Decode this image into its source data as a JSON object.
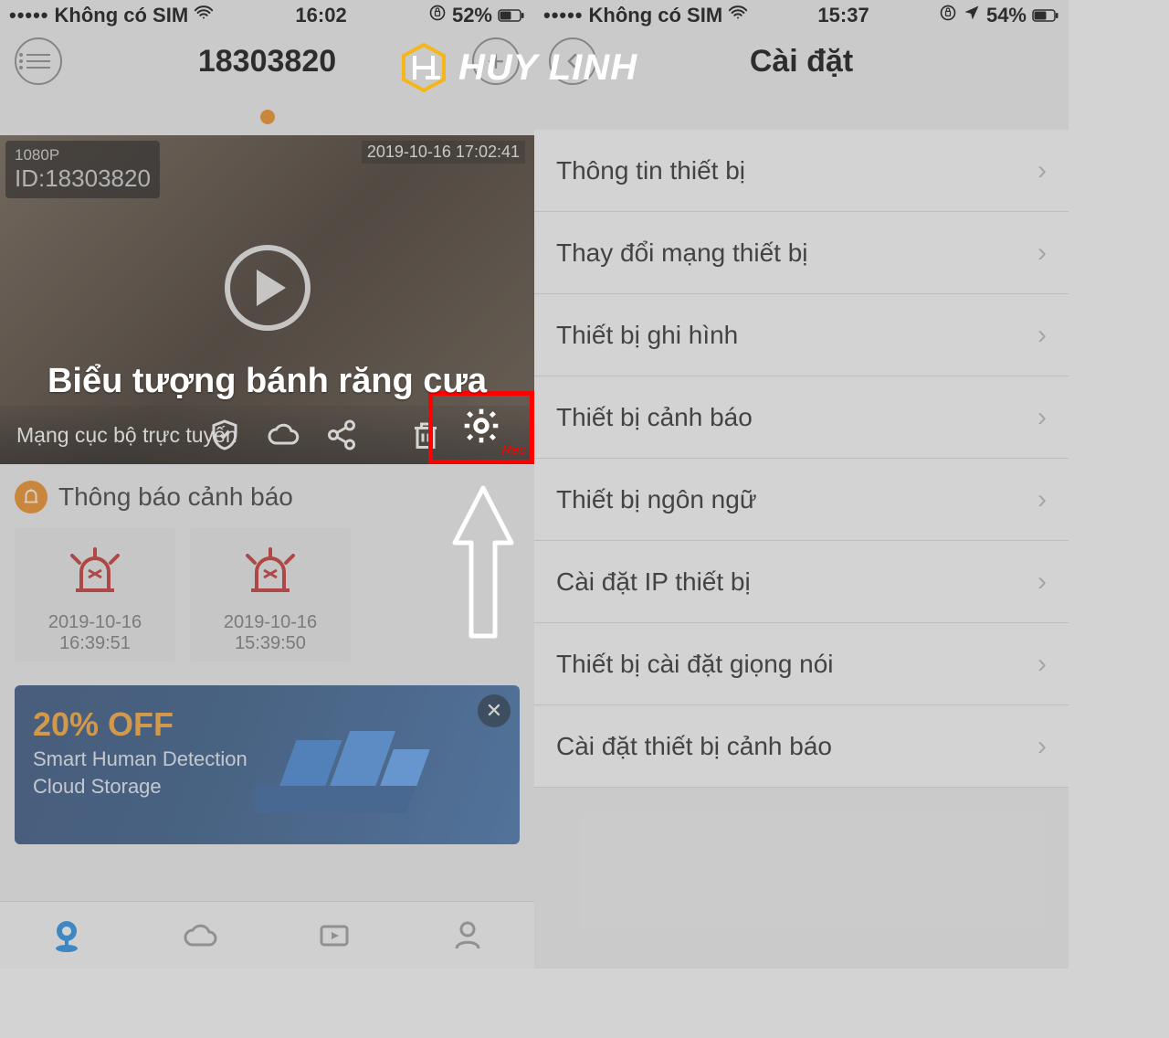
{
  "left": {
    "statusbar": {
      "carrier": "Không có SIM",
      "time": "16:02",
      "battery": "52%"
    },
    "title": "18303820",
    "video": {
      "resolution": "1080P",
      "id_label": "ID:18303820",
      "timestamp": "2019-10-16  17:02:41",
      "status": "Mạng cục bộ trực tuyến",
      "rec": "Rec"
    },
    "annotation": "Biểu tượng bánh răng cưa",
    "alerts": {
      "title": "Thông báo cảnh báo",
      "items": [
        {
          "time": "2019-10-16 16:39:51"
        },
        {
          "time": "2019-10-16 15:39:50"
        }
      ]
    },
    "banner": {
      "off": "20% OFF",
      "line1": "Smart  Human Detection",
      "line2": "Cloud Storage"
    }
  },
  "right": {
    "statusbar": {
      "carrier": "Không có SIM",
      "time": "15:37",
      "battery": "54%"
    },
    "title": "Cài đặt",
    "items": [
      "Thông tin thiết bị",
      "Thay đổi mạng thiết bị",
      "Thiết bị ghi hình",
      "Thiết bị cảnh báo",
      "Thiết bị ngôn ngữ",
      "Cài đặt IP thiết bị",
      "Thiết bị cài đặt giọng nói",
      "Cài đặt thiết bị cảnh báo"
    ]
  },
  "logo": "HUY LINH"
}
